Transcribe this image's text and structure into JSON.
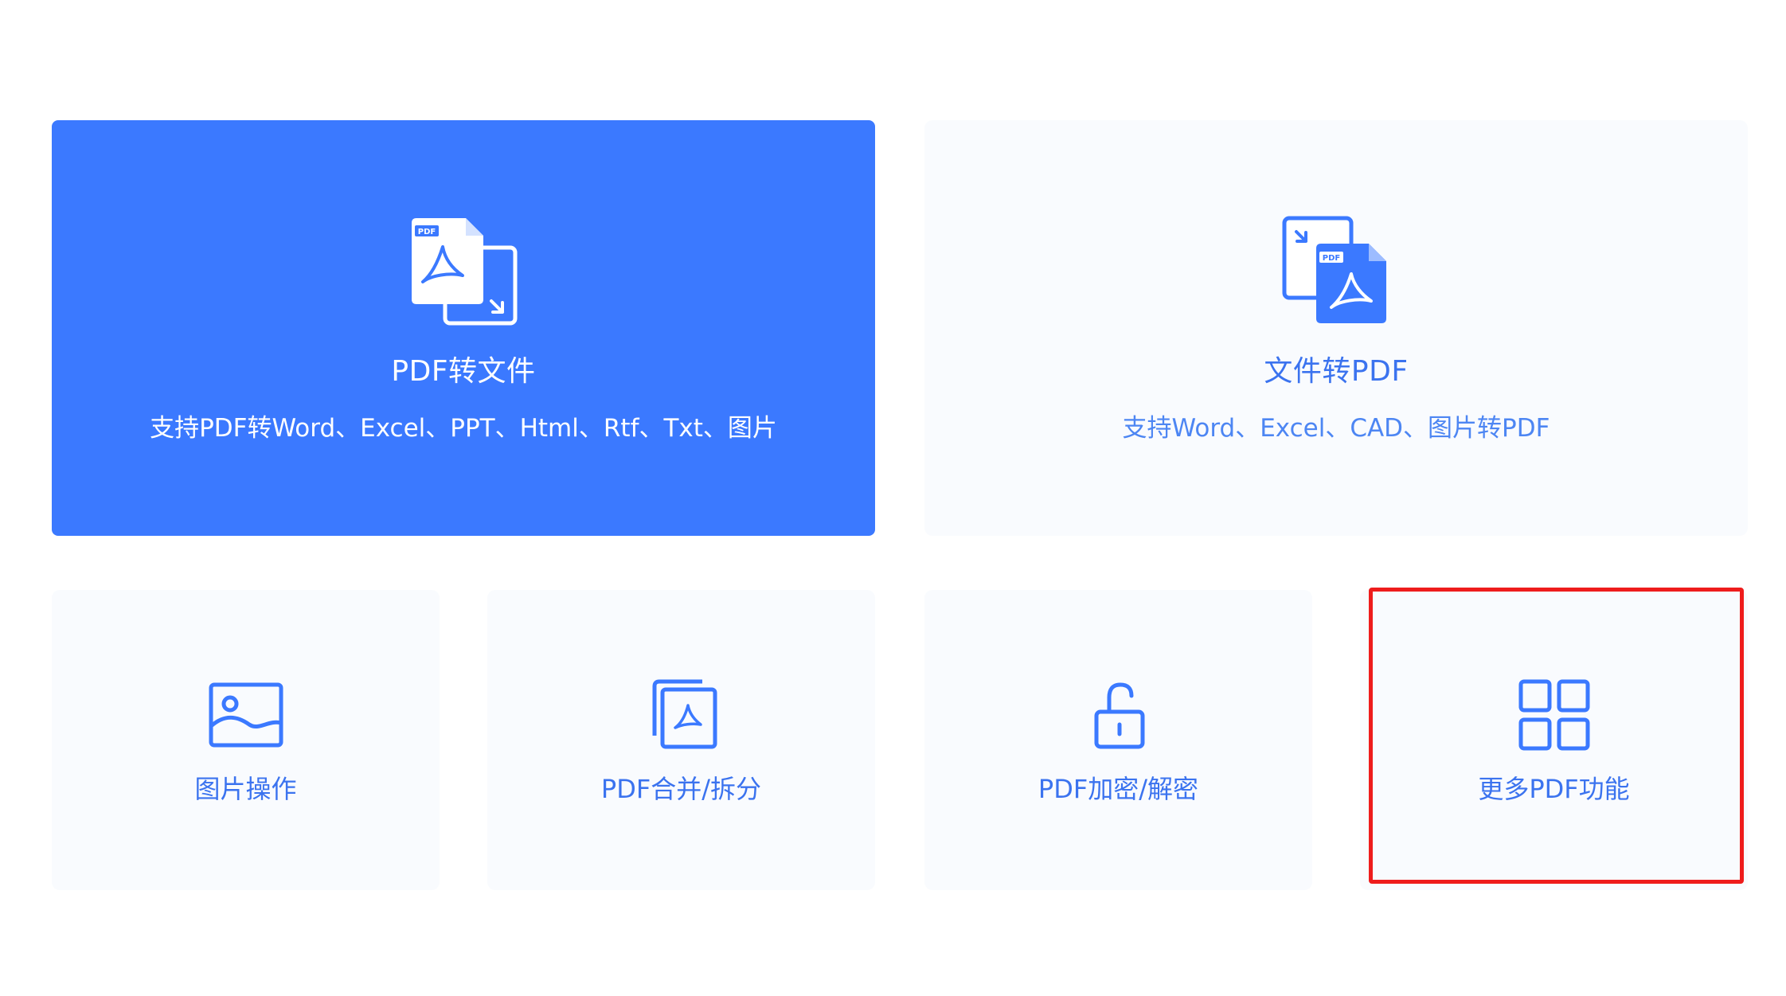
{
  "cards": {
    "pdf_to_file": {
      "title": "PDF转文件",
      "subtitle": "支持PDF转Word、Excel、PPT、Html、Rtf、Txt、图片",
      "icon": "pdf-to-file-icon",
      "selected": true
    },
    "file_to_pdf": {
      "title": "文件转PDF",
      "subtitle": "支持Word、Excel、CAD、图片转PDF",
      "icon": "file-to-pdf-icon"
    },
    "image_ops": {
      "label": "图片操作",
      "icon": "image-icon"
    },
    "pdf_merge_split": {
      "label": "PDF合并/拆分",
      "icon": "pdf-pages-icon"
    },
    "pdf_encrypt": {
      "label": "PDF加密/解密",
      "icon": "unlock-icon"
    },
    "more_pdf": {
      "label": "更多PDF功能",
      "icon": "grid-icon",
      "highlighted": true
    }
  },
  "badges": {
    "pdf": "PDF"
  },
  "colors": {
    "primary": "#3b79ff",
    "card_bg": "#f9fbfe",
    "accent_text": "#3b73ef",
    "highlight": "#ee1c1c"
  }
}
